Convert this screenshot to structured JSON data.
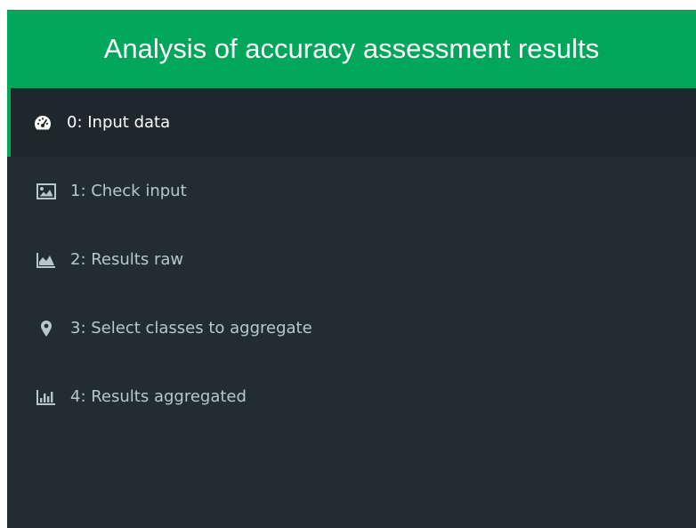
{
  "header": {
    "title": "Analysis of accuracy assessment results"
  },
  "colors": {
    "brand_green": "#00a65a",
    "sidebar_bg": "#222d32",
    "active_bg": "#1e282c",
    "text_inactive": "#b8c7ce",
    "text_active": "#ffffff"
  },
  "menu": {
    "items": [
      {
        "label": "0: Input data",
        "icon": "dashboard-icon",
        "active": true
      },
      {
        "label": "1: Check input",
        "icon": "image-icon",
        "active": false
      },
      {
        "label": "2: Results raw",
        "icon": "area-chart-icon",
        "active": false
      },
      {
        "label": "3: Select classes to aggregate",
        "icon": "map-marker-icon",
        "active": false
      },
      {
        "label": "4: Results aggregated",
        "icon": "bar-chart-icon",
        "active": false
      }
    ]
  }
}
